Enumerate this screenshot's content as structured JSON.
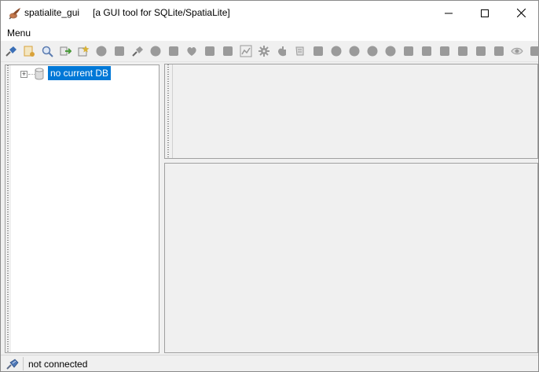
{
  "window": {
    "title": "spatialite_gui",
    "subtitle": "[a GUI tool for SQLite/SpatiaLite]",
    "controls": {
      "minimize": "minimize",
      "maximize": "maximize",
      "close": "close"
    }
  },
  "menubar": {
    "items": [
      {
        "label": "Menu"
      }
    ]
  },
  "toolbar": {
    "buttons": [
      {
        "icon": "connect-db-icon",
        "color": "#3b6fb6"
      },
      {
        "icon": "create-db-icon",
        "color": "#d9a23a"
      },
      {
        "icon": "memory-db-icon",
        "color": "#5a7bb0"
      },
      {
        "icon": "export-db-icon",
        "color": "#4a9a3a"
      },
      {
        "icon": "vacuum-db-icon",
        "color": "#d8b23a"
      },
      {
        "icon": "disconnect-icon",
        "color": "#9a9a9a"
      },
      {
        "icon": "sql-script-icon",
        "color": "#9a9a9a"
      },
      {
        "icon": "load-shp-icon",
        "color": "#9a9a9a"
      },
      {
        "icon": "virtual-shp-icon",
        "color": "#9a9a9a"
      },
      {
        "icon": "virtual-csv-icon",
        "color": "#9a9a9a"
      },
      {
        "icon": "load-xl-icon",
        "color": "#9a9a9a"
      },
      {
        "icon": "load-dbf-icon",
        "color": "#9a9a9a"
      },
      {
        "icon": "network-icon",
        "color": "#9a9a9a"
      },
      {
        "icon": "chart-icon",
        "color": "#9a9a9a"
      },
      {
        "icon": "gear-icon",
        "color": "#9a9a9a"
      },
      {
        "icon": "hand-icon",
        "color": "#9a9a9a"
      },
      {
        "icon": "script-icon",
        "color": "#9a9a9a"
      },
      {
        "icon": "table-icon",
        "color": "#9a9a9a"
      },
      {
        "icon": "tool-a-icon",
        "color": "#9a9a9a"
      },
      {
        "icon": "tool-b-icon",
        "color": "#9a9a9a"
      },
      {
        "icon": "tool-c-icon",
        "color": "#9a9a9a"
      },
      {
        "icon": "tool-d-icon",
        "color": "#9a9a9a"
      },
      {
        "icon": "tool-e-icon",
        "color": "#9a9a9a"
      },
      {
        "icon": "tool-f-icon",
        "color": "#9a9a9a"
      },
      {
        "icon": "tool-g-icon",
        "color": "#9a9a9a"
      },
      {
        "icon": "tool-h-icon",
        "color": "#9a9a9a"
      },
      {
        "icon": "tool-i-icon",
        "color": "#9a9a9a"
      },
      {
        "icon": "tool-j-icon",
        "color": "#9a9a9a"
      },
      {
        "icon": "eye-icon",
        "color": "#9a9a9a"
      },
      {
        "icon": "help-icon",
        "color": "#9a9a9a"
      }
    ]
  },
  "tree": {
    "root_label": "no current DB",
    "selection_color": "#0078d7"
  },
  "statusbar": {
    "text": "not connected"
  }
}
